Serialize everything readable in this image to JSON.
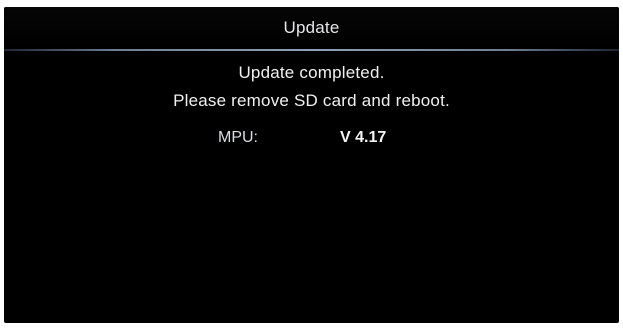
{
  "screen": {
    "title": "Update",
    "message_line_1": "Update completed.",
    "message_line_2": "Please remove SD card and reboot.",
    "version": {
      "label": "MPU:",
      "value": "V 4.17"
    }
  },
  "colors": {
    "background": "#000000",
    "text": "#f0f0f0",
    "divider": "#8fa1b3"
  }
}
